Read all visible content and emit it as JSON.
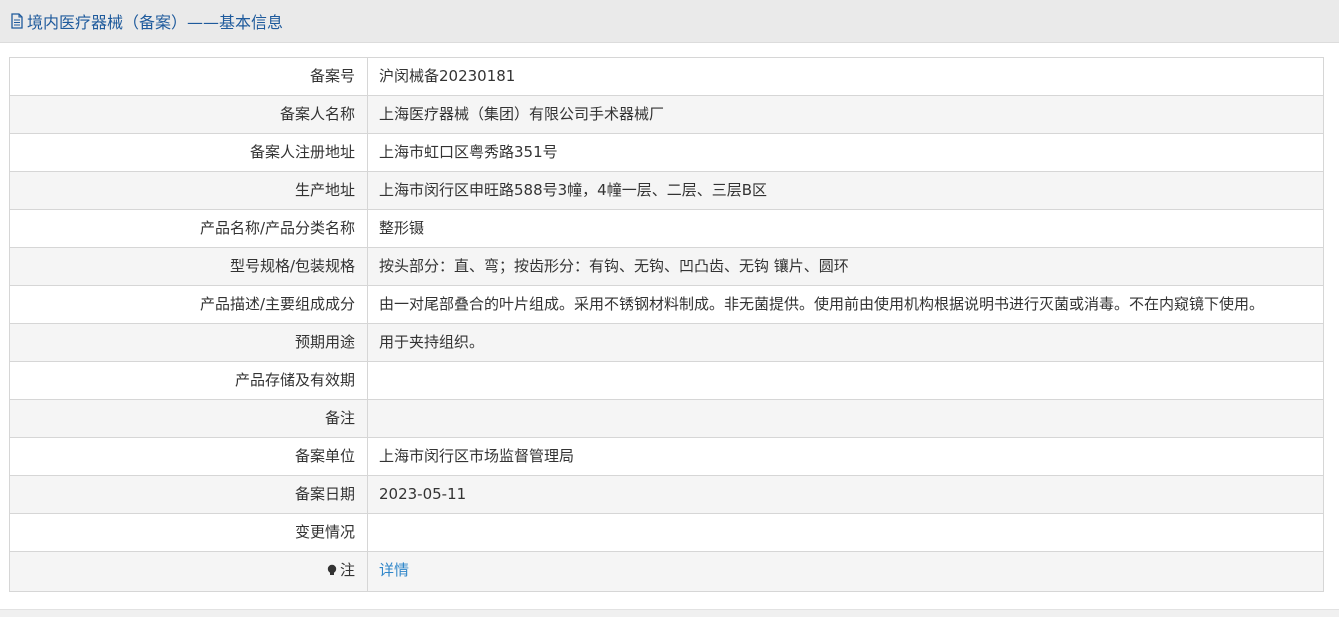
{
  "header": {
    "title": "境内医疗器械（备案）——基本信息",
    "icon": "document-icon"
  },
  "rows": [
    {
      "label": "备案号",
      "value": "沪闵械备20230181"
    },
    {
      "label": "备案人名称",
      "value": "上海医疗器械（集团）有限公司手术器械厂"
    },
    {
      "label": "备案人注册地址",
      "value": "上海市虹口区粤秀路351号"
    },
    {
      "label": "生产地址",
      "value": "上海市闵行区申旺路588号3幢，4幢一层、二层、三层B区"
    },
    {
      "label": "产品名称/产品分类名称",
      "value": "整形镊"
    },
    {
      "label": "型号规格/包装规格",
      "value": "按头部分：直、弯；按齿形分：有钩、无钩、凹凸齿、无钩 镶片、圆环"
    },
    {
      "label": "产品描述/主要组成成分",
      "value": "由一对尾部叠合的叶片组成。采用不锈钢材料制成。非无菌提供。使用前由使用机构根据说明书进行灭菌或消毒。不在内窥镜下使用。"
    },
    {
      "label": "预期用途",
      "value": "用于夹持组织。"
    },
    {
      "label": "产品存储及有效期",
      "value": ""
    },
    {
      "label": "备注",
      "value": ""
    },
    {
      "label": "备案单位",
      "value": "上海市闵行区市场监督管理局"
    },
    {
      "label": "备案日期",
      "value": "2023-05-11"
    },
    {
      "label": "变更情况",
      "value": ""
    }
  ],
  "note_row": {
    "label": "注",
    "icon": "lightbulb-icon",
    "link_text": "详情"
  },
  "colors": {
    "title": "#1e5a9c",
    "link": "#2f86c9",
    "border": "#d6d6d6",
    "stripe": "#f5f5f5"
  }
}
